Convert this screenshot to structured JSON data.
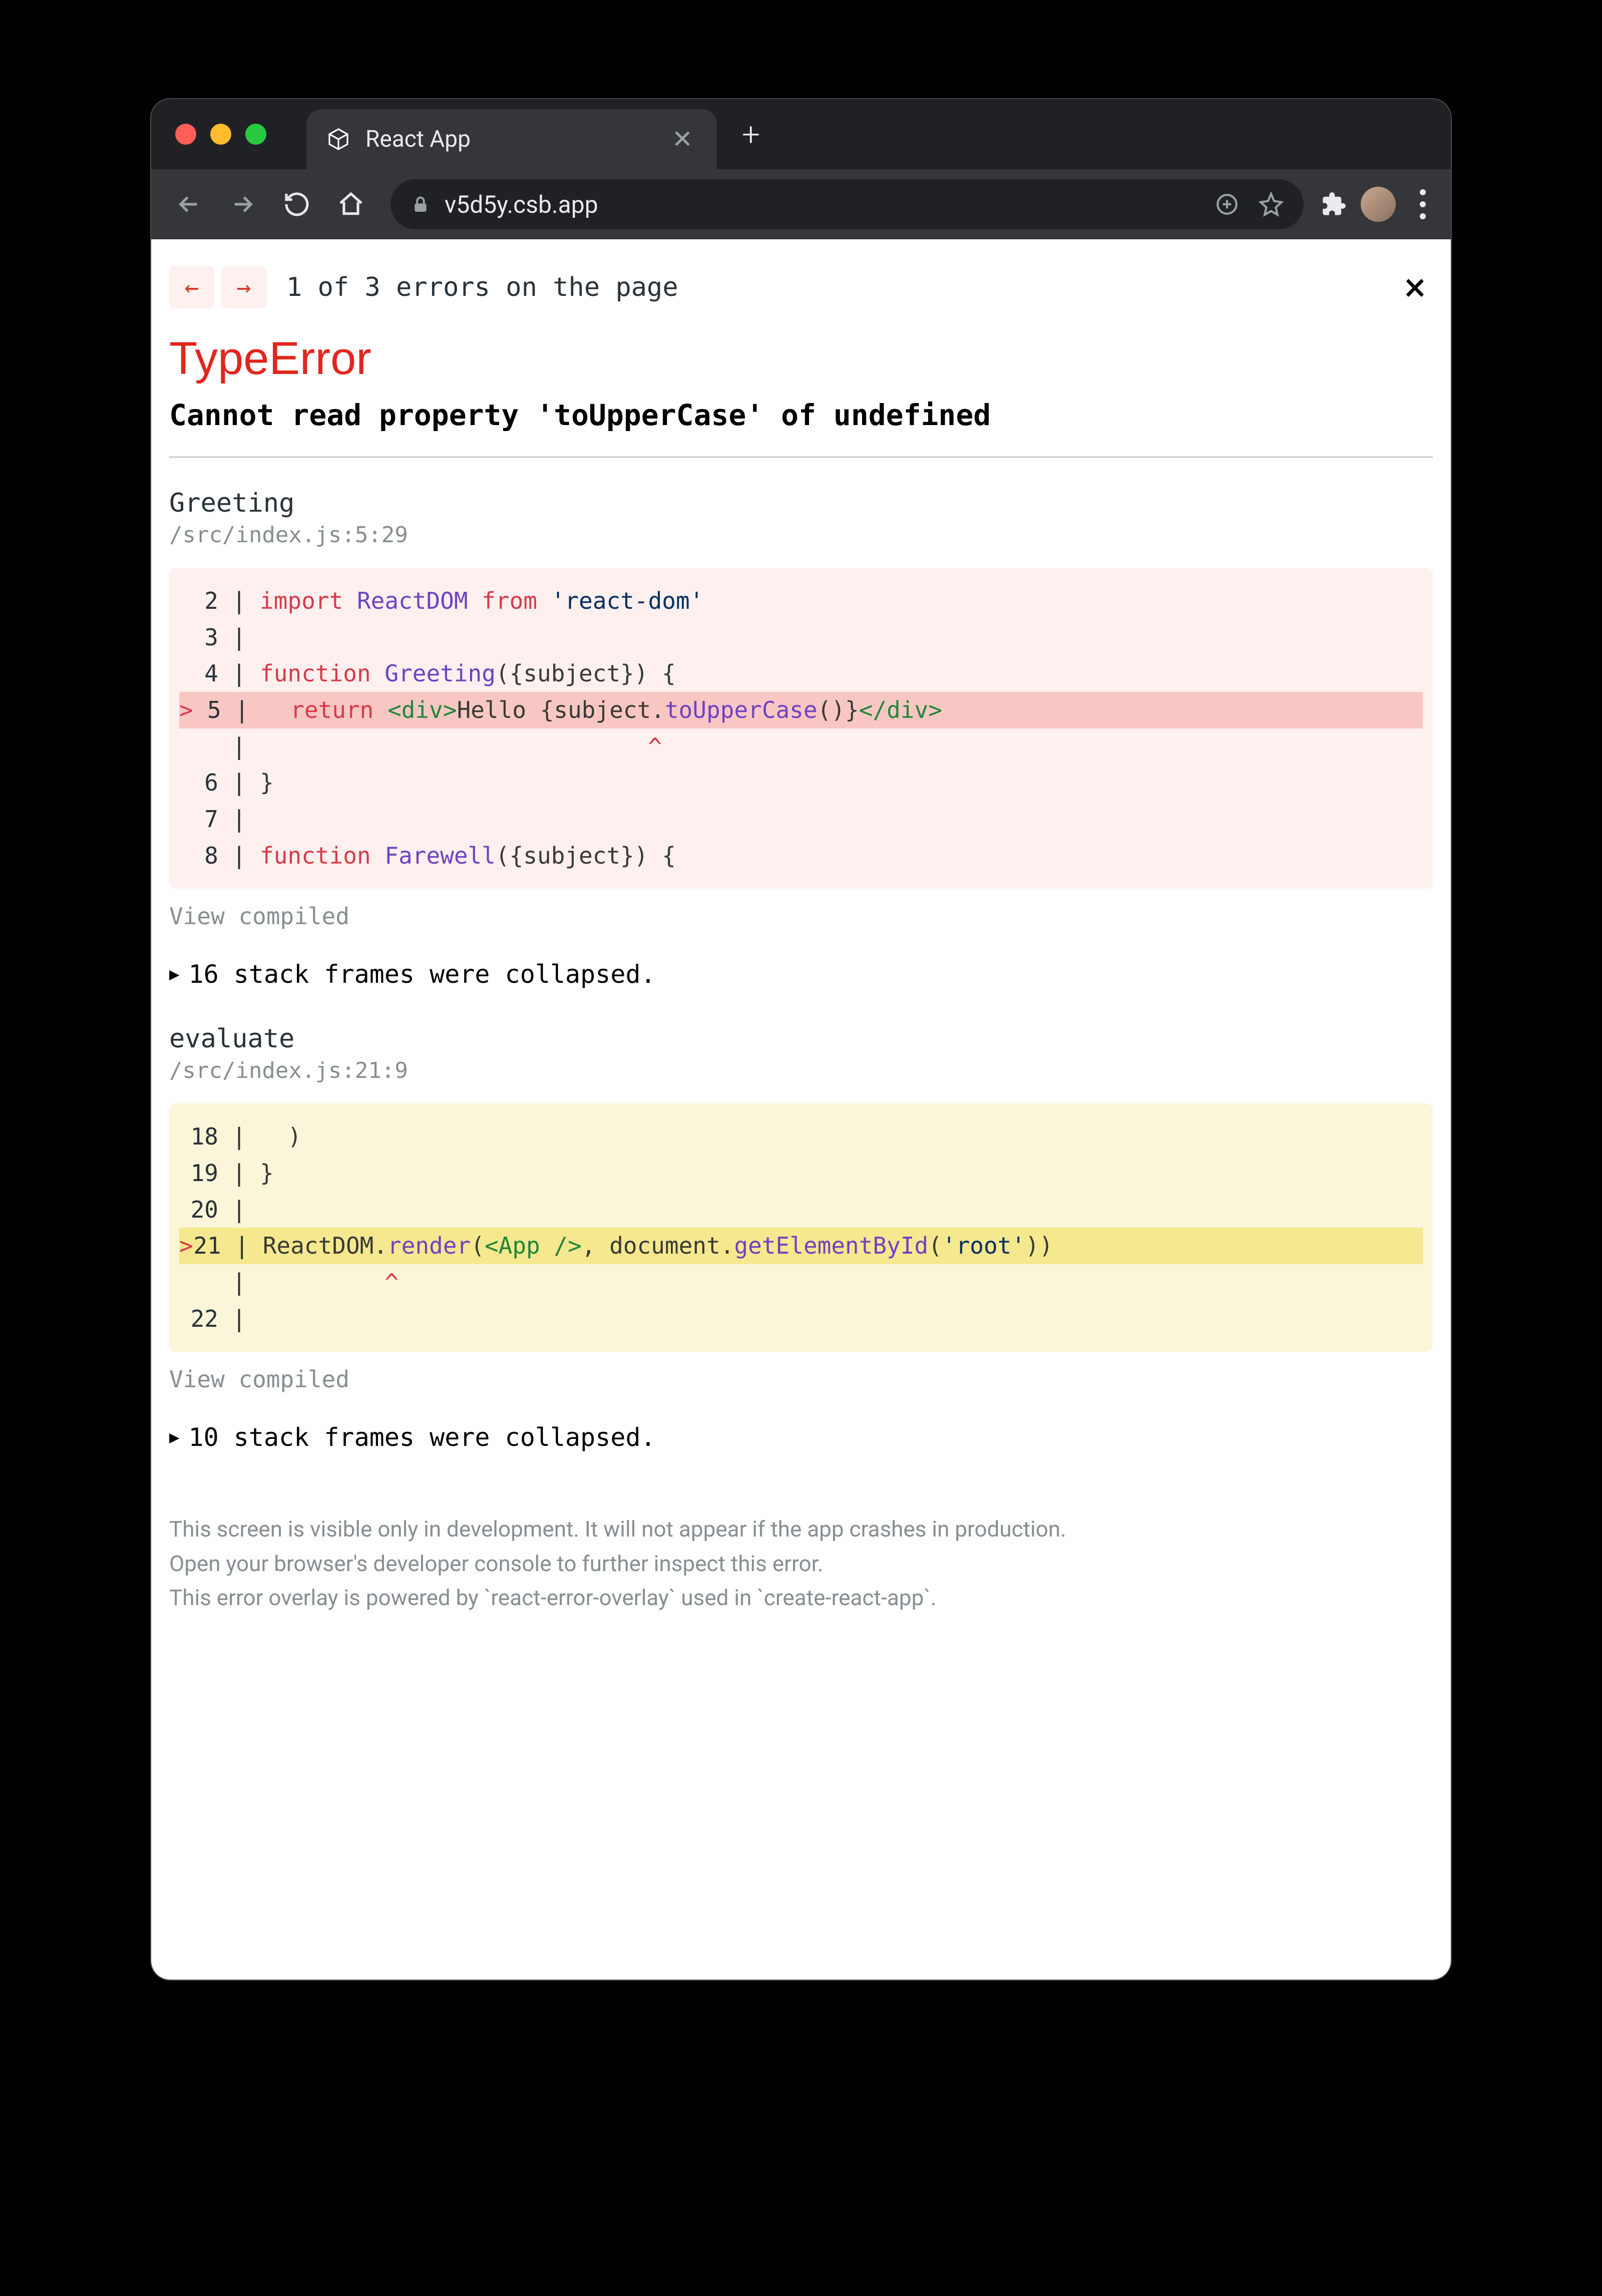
{
  "window": {
    "tab": {
      "title": "React App"
    },
    "url": "v5d5y.csb.app"
  },
  "overlay": {
    "nav": {
      "prev": "←",
      "next": "→"
    },
    "counter": "1 of 3 errors on the page",
    "close": "×",
    "error_type": "TypeError",
    "error_message": "Cannot read property 'toUpperCase' of undefined",
    "view_compiled": "View compiled",
    "frames": [
      {
        "name": "Greeting",
        "location": "/src/index.js:5:29",
        "collapsed_after": "16 stack frames were collapsed."
      },
      {
        "name": "evaluate",
        "location": "/src/index.js:21:9",
        "collapsed_after": "10 stack frames were collapsed."
      }
    ],
    "footer": {
      "line1": "This screen is visible only in development. It will not appear if the app crashes in production.",
      "line2": "Open your browser's developer console to further inspect this error.",
      "line3": "This error overlay is powered by `react-error-overlay` used in `create-react-app`."
    },
    "code_frame_1": {
      "l2": {
        "num": "2",
        "kw": "import",
        "cls": "ReactDOM",
        "from": "from",
        "str": "'react-dom'"
      },
      "l3": {
        "num": "3"
      },
      "l4": {
        "num": "4",
        "kw": "function",
        "cls": "Greeting",
        "rest": "({subject}) {"
      },
      "l5": {
        "num": "5",
        "prefix": ">",
        "kw": "return",
        "open": "<div>",
        "txt": "Hello {subject.",
        "call": "toUpperCase",
        "paren": "()}",
        "close": "</div>",
        "caret": "^"
      },
      "l6": {
        "num": "6",
        "txt": "}"
      },
      "l7": {
        "num": "7"
      },
      "l8": {
        "num": "8",
        "kw": "function",
        "cls": "Farewell",
        "rest": "({subject}) {"
      }
    },
    "code_frame_2": {
      "l18": {
        "num": "18",
        "txt": ")"
      },
      "l19": {
        "num": "19",
        "txt": "}"
      },
      "l20": {
        "num": "20"
      },
      "l21": {
        "num": "21",
        "prefix": ">",
        "obj": "ReactDOM",
        "dot": ".",
        "fn": "render",
        "open": "(",
        "tag": "<App />",
        "mid": ", document.",
        "fn2": "getElementById",
        "p2": "(",
        "str": "'root'",
        "close": "))",
        "caret": "^"
      },
      "l22": {
        "num": "22"
      }
    }
  }
}
